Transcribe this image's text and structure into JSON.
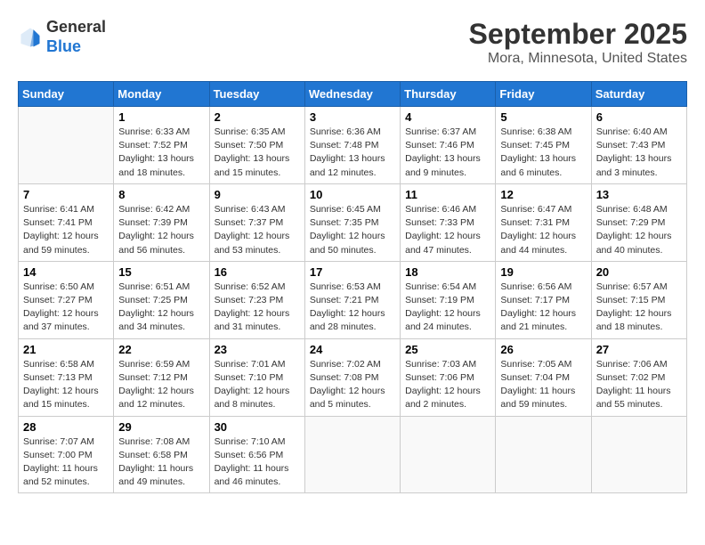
{
  "header": {
    "logo_line1": "General",
    "logo_line2": "Blue",
    "month": "September 2025",
    "location": "Mora, Minnesota, United States"
  },
  "days_of_week": [
    "Sunday",
    "Monday",
    "Tuesday",
    "Wednesday",
    "Thursday",
    "Friday",
    "Saturday"
  ],
  "weeks": [
    [
      {
        "num": "",
        "info": ""
      },
      {
        "num": "1",
        "info": "Sunrise: 6:33 AM\nSunset: 7:52 PM\nDaylight: 13 hours\nand 18 minutes."
      },
      {
        "num": "2",
        "info": "Sunrise: 6:35 AM\nSunset: 7:50 PM\nDaylight: 13 hours\nand 15 minutes."
      },
      {
        "num": "3",
        "info": "Sunrise: 6:36 AM\nSunset: 7:48 PM\nDaylight: 13 hours\nand 12 minutes."
      },
      {
        "num": "4",
        "info": "Sunrise: 6:37 AM\nSunset: 7:46 PM\nDaylight: 13 hours\nand 9 minutes."
      },
      {
        "num": "5",
        "info": "Sunrise: 6:38 AM\nSunset: 7:45 PM\nDaylight: 13 hours\nand 6 minutes."
      },
      {
        "num": "6",
        "info": "Sunrise: 6:40 AM\nSunset: 7:43 PM\nDaylight: 13 hours\nand 3 minutes."
      }
    ],
    [
      {
        "num": "7",
        "info": "Sunrise: 6:41 AM\nSunset: 7:41 PM\nDaylight: 12 hours\nand 59 minutes."
      },
      {
        "num": "8",
        "info": "Sunrise: 6:42 AM\nSunset: 7:39 PM\nDaylight: 12 hours\nand 56 minutes."
      },
      {
        "num": "9",
        "info": "Sunrise: 6:43 AM\nSunset: 7:37 PM\nDaylight: 12 hours\nand 53 minutes."
      },
      {
        "num": "10",
        "info": "Sunrise: 6:45 AM\nSunset: 7:35 PM\nDaylight: 12 hours\nand 50 minutes."
      },
      {
        "num": "11",
        "info": "Sunrise: 6:46 AM\nSunset: 7:33 PM\nDaylight: 12 hours\nand 47 minutes."
      },
      {
        "num": "12",
        "info": "Sunrise: 6:47 AM\nSunset: 7:31 PM\nDaylight: 12 hours\nand 44 minutes."
      },
      {
        "num": "13",
        "info": "Sunrise: 6:48 AM\nSunset: 7:29 PM\nDaylight: 12 hours\nand 40 minutes."
      }
    ],
    [
      {
        "num": "14",
        "info": "Sunrise: 6:50 AM\nSunset: 7:27 PM\nDaylight: 12 hours\nand 37 minutes."
      },
      {
        "num": "15",
        "info": "Sunrise: 6:51 AM\nSunset: 7:25 PM\nDaylight: 12 hours\nand 34 minutes."
      },
      {
        "num": "16",
        "info": "Sunrise: 6:52 AM\nSunset: 7:23 PM\nDaylight: 12 hours\nand 31 minutes."
      },
      {
        "num": "17",
        "info": "Sunrise: 6:53 AM\nSunset: 7:21 PM\nDaylight: 12 hours\nand 28 minutes."
      },
      {
        "num": "18",
        "info": "Sunrise: 6:54 AM\nSunset: 7:19 PM\nDaylight: 12 hours\nand 24 minutes."
      },
      {
        "num": "19",
        "info": "Sunrise: 6:56 AM\nSunset: 7:17 PM\nDaylight: 12 hours\nand 21 minutes."
      },
      {
        "num": "20",
        "info": "Sunrise: 6:57 AM\nSunset: 7:15 PM\nDaylight: 12 hours\nand 18 minutes."
      }
    ],
    [
      {
        "num": "21",
        "info": "Sunrise: 6:58 AM\nSunset: 7:13 PM\nDaylight: 12 hours\nand 15 minutes."
      },
      {
        "num": "22",
        "info": "Sunrise: 6:59 AM\nSunset: 7:12 PM\nDaylight: 12 hours\nand 12 minutes."
      },
      {
        "num": "23",
        "info": "Sunrise: 7:01 AM\nSunset: 7:10 PM\nDaylight: 12 hours\nand 8 minutes."
      },
      {
        "num": "24",
        "info": "Sunrise: 7:02 AM\nSunset: 7:08 PM\nDaylight: 12 hours\nand 5 minutes."
      },
      {
        "num": "25",
        "info": "Sunrise: 7:03 AM\nSunset: 7:06 PM\nDaylight: 12 hours\nand 2 minutes."
      },
      {
        "num": "26",
        "info": "Sunrise: 7:05 AM\nSunset: 7:04 PM\nDaylight: 11 hours\nand 59 minutes."
      },
      {
        "num": "27",
        "info": "Sunrise: 7:06 AM\nSunset: 7:02 PM\nDaylight: 11 hours\nand 55 minutes."
      }
    ],
    [
      {
        "num": "28",
        "info": "Sunrise: 7:07 AM\nSunset: 7:00 PM\nDaylight: 11 hours\nand 52 minutes."
      },
      {
        "num": "29",
        "info": "Sunrise: 7:08 AM\nSunset: 6:58 PM\nDaylight: 11 hours\nand 49 minutes."
      },
      {
        "num": "30",
        "info": "Sunrise: 7:10 AM\nSunset: 6:56 PM\nDaylight: 11 hours\nand 46 minutes."
      },
      {
        "num": "",
        "info": ""
      },
      {
        "num": "",
        "info": ""
      },
      {
        "num": "",
        "info": ""
      },
      {
        "num": "",
        "info": ""
      }
    ]
  ]
}
